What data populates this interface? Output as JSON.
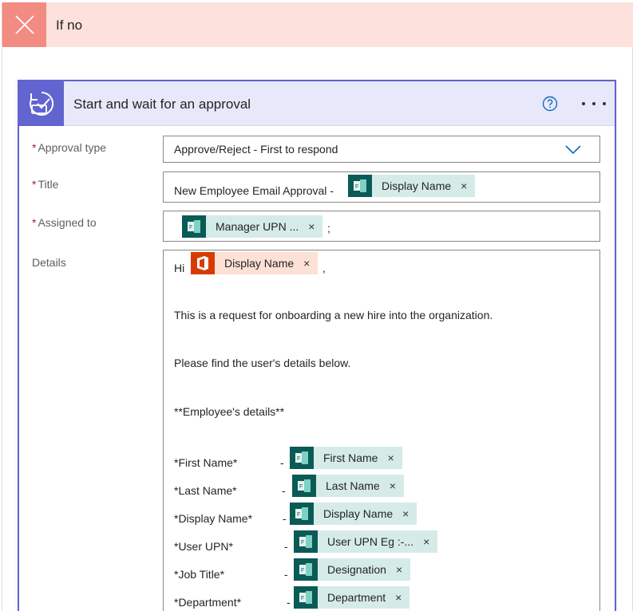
{
  "branch": {
    "title": "If no"
  },
  "action": {
    "title": "Start and wait for an approval"
  },
  "fields": {
    "approval_type": {
      "label": "Approval type",
      "value": "Approve/Reject - First to respond"
    },
    "title": {
      "label": "Title",
      "prefix": "New Employee Email Approval -",
      "token": "Display Name"
    },
    "assigned_to": {
      "label": "Assigned to",
      "token": "Manager UPN ...",
      "suffix": ";"
    },
    "details": {
      "label": "Details",
      "greeting": "Hi",
      "greeting_token": "Display Name",
      "greeting_suffix": ",",
      "line1": "This is a request for onboarding a new hire into the organization.",
      "line2": "Please find the user's details below.",
      "line3": "**Employee's details**",
      "rows": [
        {
          "label": "*First Name*",
          "dash": "-",
          "token": "First Name"
        },
        {
          "label": "*Last Name*",
          "dash": "-",
          "token": "Last Name"
        },
        {
          "label": "*Display Name*",
          "dash": "-",
          "token": "Display Name"
        },
        {
          "label": "*User UPN*",
          "dash": "-",
          "token": "User UPN Eg :-..."
        },
        {
          "label": "*Job Title*",
          "dash": "-",
          "token": "Designation"
        },
        {
          "label": "*Department*",
          "dash": "-",
          "token": "Department"
        }
      ]
    }
  },
  "remove_glyph": "×",
  "required_mark": "*",
  "colors": {
    "accent": "#6264d0",
    "branch_no": "#f28b82",
    "forms_token": "#0a5b56",
    "office_token": "#d83b01"
  }
}
